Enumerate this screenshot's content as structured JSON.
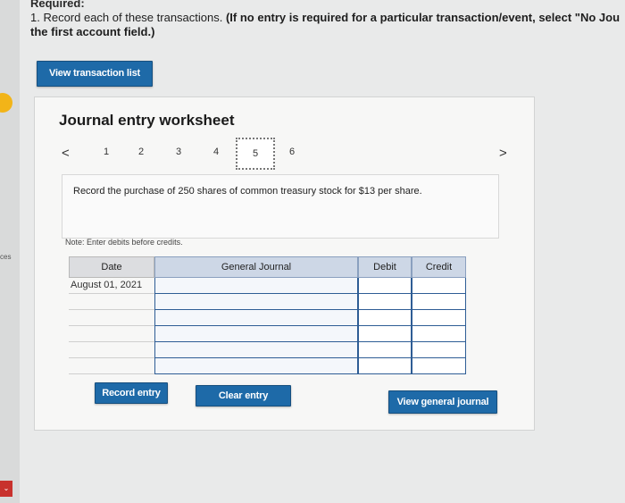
{
  "header": {
    "required": "Required:",
    "instruction_prefix": "1. Record each of these transactions. ",
    "instruction_bold": "(If no entry is required for a particular transaction/event, select \"No Jou",
    "instruction_line2": "the first account field.)"
  },
  "sidebar": {
    "label": "ces"
  },
  "toolbar": {
    "view_transaction_list": "View transaction list"
  },
  "worksheet": {
    "title": "Journal entry worksheet",
    "steps": [
      "1",
      "2",
      "3",
      "4",
      "5",
      "6"
    ],
    "active_step": "5",
    "prev_glyph": "<",
    "next_glyph": ">",
    "description": "Record the purchase of 250 shares of common treasury stock for $13 per share.",
    "note": "Note: Enter debits before credits."
  },
  "table": {
    "headers": {
      "date": "Date",
      "general_journal": "General Journal",
      "debit": "Debit",
      "credit": "Credit"
    },
    "first_date": "August 01, 2021",
    "row_count": 6
  },
  "buttons": {
    "record_entry": "Record entry",
    "clear_entry": "Clear entry",
    "view_general_journal": "View general journal"
  },
  "colors": {
    "button_blue": "#1e6aa8",
    "header_blue": "#cdd7e6",
    "cell_border": "#2e5d95"
  }
}
